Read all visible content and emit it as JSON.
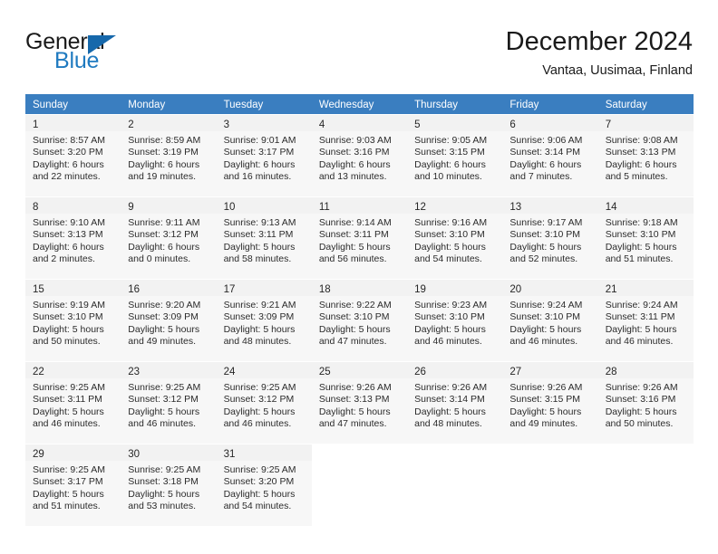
{
  "brand": {
    "general": "General",
    "blue": "Blue",
    "triangle_color": "#1668ab",
    "blue_color": "#1f7ac0"
  },
  "header": {
    "title": "December 2024",
    "subtitle": "Vantaa, Uusimaa, Finland",
    "weekday_header_bg": "#3a7ec0"
  },
  "weekdays": [
    "Sunday",
    "Monday",
    "Tuesday",
    "Wednesday",
    "Thursday",
    "Friday",
    "Saturday"
  ],
  "weeks": [
    [
      {
        "day": "1",
        "sunrise": "Sunrise: 8:57 AM",
        "sunset": "Sunset: 3:20 PM",
        "daylight_line1": "Daylight: 6 hours",
        "daylight_line2": "and 22 minutes."
      },
      {
        "day": "2",
        "sunrise": "Sunrise: 8:59 AM",
        "sunset": "Sunset: 3:19 PM",
        "daylight_line1": "Daylight: 6 hours",
        "daylight_line2": "and 19 minutes."
      },
      {
        "day": "3",
        "sunrise": "Sunrise: 9:01 AM",
        "sunset": "Sunset: 3:17 PM",
        "daylight_line1": "Daylight: 6 hours",
        "daylight_line2": "and 16 minutes."
      },
      {
        "day": "4",
        "sunrise": "Sunrise: 9:03 AM",
        "sunset": "Sunset: 3:16 PM",
        "daylight_line1": "Daylight: 6 hours",
        "daylight_line2": "and 13 minutes."
      },
      {
        "day": "5",
        "sunrise": "Sunrise: 9:05 AM",
        "sunset": "Sunset: 3:15 PM",
        "daylight_line1": "Daylight: 6 hours",
        "daylight_line2": "and 10 minutes."
      },
      {
        "day": "6",
        "sunrise": "Sunrise: 9:06 AM",
        "sunset": "Sunset: 3:14 PM",
        "daylight_line1": "Daylight: 6 hours",
        "daylight_line2": "and 7 minutes."
      },
      {
        "day": "7",
        "sunrise": "Sunrise: 9:08 AM",
        "sunset": "Sunset: 3:13 PM",
        "daylight_line1": "Daylight: 6 hours",
        "daylight_line2": "and 5 minutes."
      }
    ],
    [
      {
        "day": "8",
        "sunrise": "Sunrise: 9:10 AM",
        "sunset": "Sunset: 3:13 PM",
        "daylight_line1": "Daylight: 6 hours",
        "daylight_line2": "and 2 minutes."
      },
      {
        "day": "9",
        "sunrise": "Sunrise: 9:11 AM",
        "sunset": "Sunset: 3:12 PM",
        "daylight_line1": "Daylight: 6 hours",
        "daylight_line2": "and 0 minutes."
      },
      {
        "day": "10",
        "sunrise": "Sunrise: 9:13 AM",
        "sunset": "Sunset: 3:11 PM",
        "daylight_line1": "Daylight: 5 hours",
        "daylight_line2": "and 58 minutes."
      },
      {
        "day": "11",
        "sunrise": "Sunrise: 9:14 AM",
        "sunset": "Sunset: 3:11 PM",
        "daylight_line1": "Daylight: 5 hours",
        "daylight_line2": "and 56 minutes."
      },
      {
        "day": "12",
        "sunrise": "Sunrise: 9:16 AM",
        "sunset": "Sunset: 3:10 PM",
        "daylight_line1": "Daylight: 5 hours",
        "daylight_line2": "and 54 minutes."
      },
      {
        "day": "13",
        "sunrise": "Sunrise: 9:17 AM",
        "sunset": "Sunset: 3:10 PM",
        "daylight_line1": "Daylight: 5 hours",
        "daylight_line2": "and 52 minutes."
      },
      {
        "day": "14",
        "sunrise": "Sunrise: 9:18 AM",
        "sunset": "Sunset: 3:10 PM",
        "daylight_line1": "Daylight: 5 hours",
        "daylight_line2": "and 51 minutes."
      }
    ],
    [
      {
        "day": "15",
        "sunrise": "Sunrise: 9:19 AM",
        "sunset": "Sunset: 3:10 PM",
        "daylight_line1": "Daylight: 5 hours",
        "daylight_line2": "and 50 minutes."
      },
      {
        "day": "16",
        "sunrise": "Sunrise: 9:20 AM",
        "sunset": "Sunset: 3:09 PM",
        "daylight_line1": "Daylight: 5 hours",
        "daylight_line2": "and 49 minutes."
      },
      {
        "day": "17",
        "sunrise": "Sunrise: 9:21 AM",
        "sunset": "Sunset: 3:09 PM",
        "daylight_line1": "Daylight: 5 hours",
        "daylight_line2": "and 48 minutes."
      },
      {
        "day": "18",
        "sunrise": "Sunrise: 9:22 AM",
        "sunset": "Sunset: 3:10 PM",
        "daylight_line1": "Daylight: 5 hours",
        "daylight_line2": "and 47 minutes."
      },
      {
        "day": "19",
        "sunrise": "Sunrise: 9:23 AM",
        "sunset": "Sunset: 3:10 PM",
        "daylight_line1": "Daylight: 5 hours",
        "daylight_line2": "and 46 minutes."
      },
      {
        "day": "20",
        "sunrise": "Sunrise: 9:24 AM",
        "sunset": "Sunset: 3:10 PM",
        "daylight_line1": "Daylight: 5 hours",
        "daylight_line2": "and 46 minutes."
      },
      {
        "day": "21",
        "sunrise": "Sunrise: 9:24 AM",
        "sunset": "Sunset: 3:11 PM",
        "daylight_line1": "Daylight: 5 hours",
        "daylight_line2": "and 46 minutes."
      }
    ],
    [
      {
        "day": "22",
        "sunrise": "Sunrise: 9:25 AM",
        "sunset": "Sunset: 3:11 PM",
        "daylight_line1": "Daylight: 5 hours",
        "daylight_line2": "and 46 minutes."
      },
      {
        "day": "23",
        "sunrise": "Sunrise: 9:25 AM",
        "sunset": "Sunset: 3:12 PM",
        "daylight_line1": "Daylight: 5 hours",
        "daylight_line2": "and 46 minutes."
      },
      {
        "day": "24",
        "sunrise": "Sunrise: 9:25 AM",
        "sunset": "Sunset: 3:12 PM",
        "daylight_line1": "Daylight: 5 hours",
        "daylight_line2": "and 46 minutes."
      },
      {
        "day": "25",
        "sunrise": "Sunrise: 9:26 AM",
        "sunset": "Sunset: 3:13 PM",
        "daylight_line1": "Daylight: 5 hours",
        "daylight_line2": "and 47 minutes."
      },
      {
        "day": "26",
        "sunrise": "Sunrise: 9:26 AM",
        "sunset": "Sunset: 3:14 PM",
        "daylight_line1": "Daylight: 5 hours",
        "daylight_line2": "and 48 minutes."
      },
      {
        "day": "27",
        "sunrise": "Sunrise: 9:26 AM",
        "sunset": "Sunset: 3:15 PM",
        "daylight_line1": "Daylight: 5 hours",
        "daylight_line2": "and 49 minutes."
      },
      {
        "day": "28",
        "sunrise": "Sunrise: 9:26 AM",
        "sunset": "Sunset: 3:16 PM",
        "daylight_line1": "Daylight: 5 hours",
        "daylight_line2": "and 50 minutes."
      }
    ],
    [
      {
        "day": "29",
        "sunrise": "Sunrise: 9:25 AM",
        "sunset": "Sunset: 3:17 PM",
        "daylight_line1": "Daylight: 5 hours",
        "daylight_line2": "and 51 minutes."
      },
      {
        "day": "30",
        "sunrise": "Sunrise: 9:25 AM",
        "sunset": "Sunset: 3:18 PM",
        "daylight_line1": "Daylight: 5 hours",
        "daylight_line2": "and 53 minutes."
      },
      {
        "day": "31",
        "sunrise": "Sunrise: 9:25 AM",
        "sunset": "Sunset: 3:20 PM",
        "daylight_line1": "Daylight: 5 hours",
        "daylight_line2": "and 54 minutes."
      },
      {
        "day": "",
        "sunrise": "",
        "sunset": "",
        "daylight_line1": "",
        "daylight_line2": ""
      },
      {
        "day": "",
        "sunrise": "",
        "sunset": "",
        "daylight_line1": "",
        "daylight_line2": ""
      },
      {
        "day": "",
        "sunrise": "",
        "sunset": "",
        "daylight_line1": "",
        "daylight_line2": ""
      },
      {
        "day": "",
        "sunrise": "",
        "sunset": "",
        "daylight_line1": "",
        "daylight_line2": ""
      }
    ]
  ]
}
